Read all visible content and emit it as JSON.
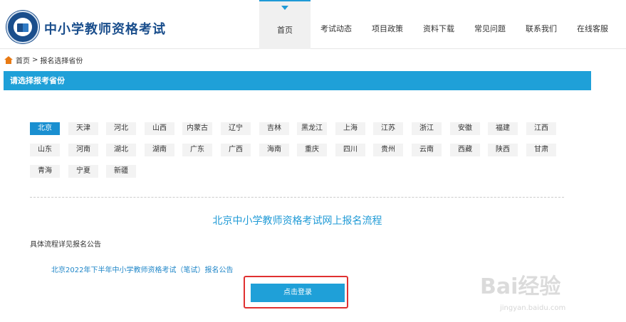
{
  "header": {
    "site_title": "中小学教师资格考试",
    "nav": [
      {
        "label": "首页",
        "active": true
      },
      {
        "label": "考试动态",
        "active": false
      },
      {
        "label": "项目政策",
        "active": false
      },
      {
        "label": "资料下载",
        "active": false
      },
      {
        "label": "常见问题",
        "active": false
      },
      {
        "label": "联系我们",
        "active": false
      },
      {
        "label": "在线客服",
        "active": false
      }
    ]
  },
  "breadcrumb": {
    "home": "首页",
    "separator": ">",
    "current": "报名选择省份"
  },
  "section": {
    "title": "请选择报考省份"
  },
  "provinces": [
    {
      "name": "北京",
      "active": true
    },
    {
      "name": "天津"
    },
    {
      "name": "河北"
    },
    {
      "name": "山西"
    },
    {
      "name": "内蒙古"
    },
    {
      "name": "辽宁"
    },
    {
      "name": "吉林"
    },
    {
      "name": "黑龙江"
    },
    {
      "name": "上海"
    },
    {
      "name": "江苏"
    },
    {
      "name": "浙江"
    },
    {
      "name": "安徽"
    },
    {
      "name": "福建"
    },
    {
      "name": "江西"
    },
    {
      "name": "山东"
    },
    {
      "name": "河南"
    },
    {
      "name": "湖北"
    },
    {
      "name": "湖南"
    },
    {
      "name": "广东"
    },
    {
      "name": "广西"
    },
    {
      "name": "海南"
    },
    {
      "name": "重庆"
    },
    {
      "name": "四川"
    },
    {
      "name": "贵州"
    },
    {
      "name": "云南"
    },
    {
      "name": "西藏"
    },
    {
      "name": "陕西"
    },
    {
      "name": "甘肃"
    },
    {
      "name": "青海"
    },
    {
      "name": "宁夏"
    },
    {
      "name": "新疆"
    }
  ],
  "flow": {
    "title": "北京中小学教师资格考试网上报名流程",
    "note": "具体流程详见报名公告",
    "notice_link": "北京2022年下半年中小学教师资格考试（笔试）报名公告",
    "login_label": "点击登录"
  },
  "watermark": {
    "text": "Bai经验",
    "sub": "jingyan.baidu.com"
  },
  "colors": {
    "accent": "#1fa0d8",
    "brand": "#1a4e8c",
    "highlight_outline": "#e03030",
    "home_icon": "#e87a14"
  }
}
